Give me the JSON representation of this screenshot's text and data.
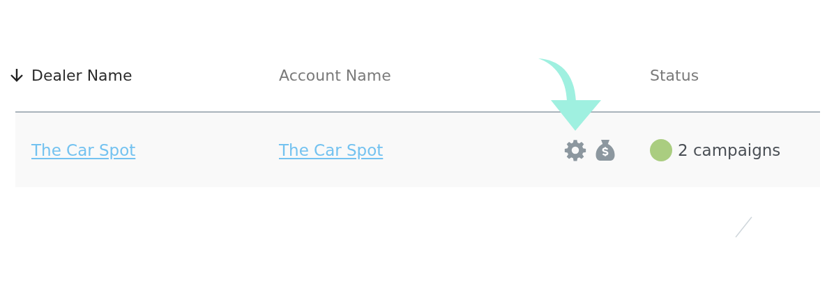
{
  "table": {
    "columns": [
      {
        "label": "Dealer Name",
        "sorted": true
      },
      {
        "label": "Account Name",
        "sorted": false
      },
      {
        "label": "Status",
        "sorted": false
      }
    ],
    "rows": [
      {
        "dealer_name": "The Car Spot",
        "account_name": "The Car Spot",
        "status": {
          "text": "2 campaigns",
          "color": "#aacd80"
        }
      }
    ]
  }
}
